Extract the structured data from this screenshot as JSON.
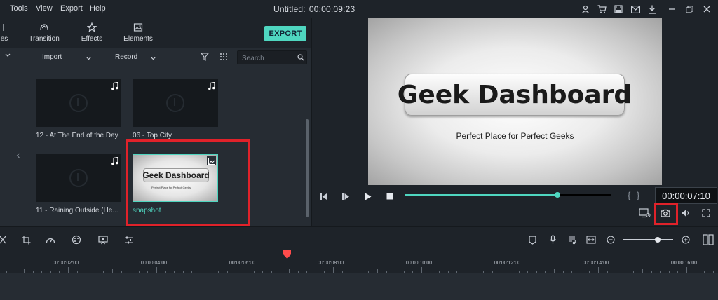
{
  "menu": {
    "items": [
      "Tools",
      "View",
      "Export",
      "Help"
    ]
  },
  "window": {
    "title": "Untitled:",
    "timecode": "00:00:09:23"
  },
  "tabs": [
    {
      "label": "es",
      "icon": "folder-icon"
    },
    {
      "label": "Transition",
      "icon": "transition-icon"
    },
    {
      "label": "Effects",
      "icon": "effects-icon"
    },
    {
      "label": "Elements",
      "icon": "elements-icon"
    }
  ],
  "export_label": "EXPORT",
  "media_toolbar": {
    "import_label": "Import",
    "record_label": "Record",
    "search_placeholder": "Search"
  },
  "media_items": [
    {
      "label": "12 - At The End of the Day",
      "type": "audio"
    },
    {
      "label": "06 - Top City",
      "type": "audio"
    },
    {
      "label": "11 - Raining Outside (He...",
      "type": "audio"
    },
    {
      "label": "snapshot",
      "type": "image",
      "selected": true
    }
  ],
  "snapshot_content": {
    "title": "Geek Dashboard",
    "tagline": "Perfect Place for Perfect Geeks"
  },
  "preview": {
    "title": "Geek Dashboard",
    "tagline": "Perfect Place for Perfect Geeks",
    "timecode": "00:00:07:10",
    "progress": 0.74,
    "brace_open": "{",
    "brace_close": "}"
  },
  "timeline": {
    "zoom_level": 0.7,
    "ruler_labels": [
      "00:00:02:00",
      "00:00:04:00",
      "00:00:06:00",
      "00:00:08:00",
      "00:00:10:00",
      "00:00:12:00",
      "00:00:14:00",
      "00:00:16:00"
    ]
  },
  "colors": {
    "accent": "#4fd6c0",
    "highlight": "#e0222a",
    "playhead": "#ff4b4b",
    "panel": "#262c33",
    "background": "#1e2329"
  }
}
